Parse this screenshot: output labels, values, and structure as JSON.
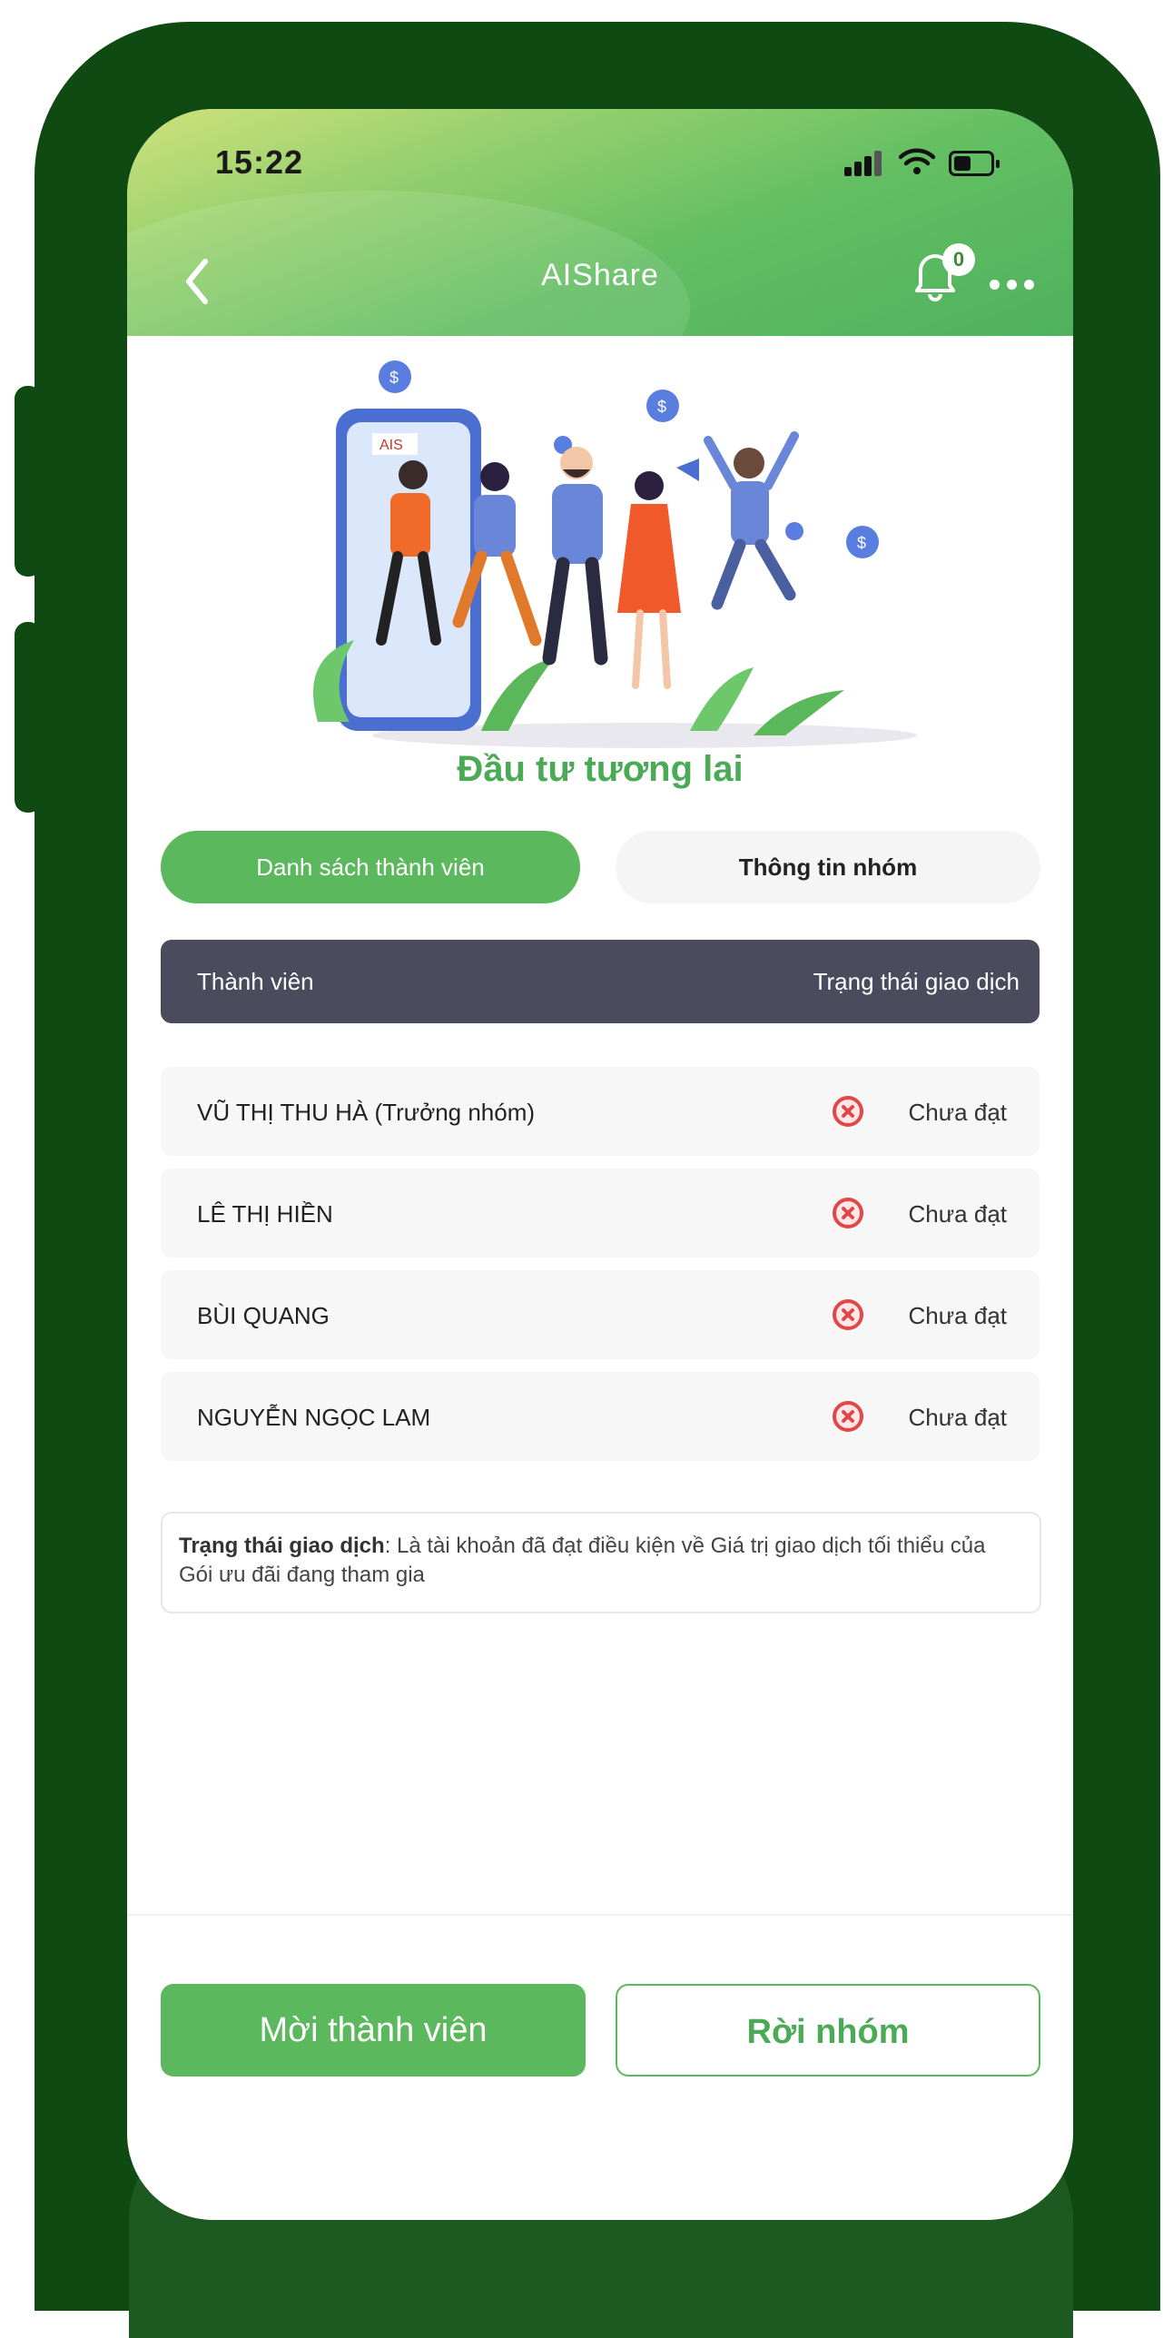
{
  "status_bar": {
    "time": "15:22"
  },
  "header": {
    "title": "AIShare",
    "notification_count": "0"
  },
  "illustration": {
    "logo_text": "AIS"
  },
  "group": {
    "name": "Đầu tư tương lai"
  },
  "tabs": [
    {
      "label": "Danh sách thành viên",
      "active": true
    },
    {
      "label": "Thông tin nhóm",
      "active": false
    }
  ],
  "table": {
    "headers": {
      "member": "Thành viên",
      "status": "Trạng thái giao dịch"
    },
    "rows": [
      {
        "name": "VŨ THỊ THU HÀ (Trưởng nhóm)",
        "status": "Chưa đạt"
      },
      {
        "name": "LÊ THỊ HIỀN",
        "status": "Chưa đạt"
      },
      {
        "name": "BÙI QUANG",
        "status": "Chưa đạt"
      },
      {
        "name": "NGUYỄN NGỌC LAM",
        "status": "Chưa đạt"
      }
    ]
  },
  "note": {
    "label": "Trạng thái giao dịch",
    "text": ": Là tài khoản đã đạt điều kiện về Giá trị giao dịch tối thiểu của Gói ưu đãi đang tham gia"
  },
  "actions": {
    "invite": "Mời thành viên",
    "leave": "Rời nhóm"
  },
  "colors": {
    "accent": "#5cb85c",
    "frame": "#0f4a12",
    "table_header": "#4a4b5d",
    "status_fail": "#e04848"
  }
}
